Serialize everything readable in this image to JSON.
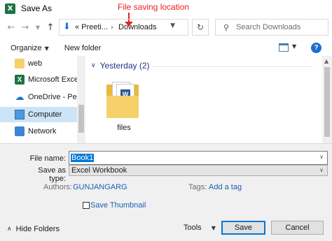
{
  "window": {
    "title": "Save As",
    "app_icon_letter": "X"
  },
  "annotation": {
    "text": "File saving location",
    "color": "#e8231f"
  },
  "nav": {
    "back_icon": "arrow-left-icon",
    "forward_icon": "arrow-right-icon",
    "recent_icon": "chevron-down-icon",
    "up_icon": "arrow-up-icon",
    "address": {
      "overflow": "«",
      "segments": [
        "Preeti...",
        "Downloads"
      ]
    },
    "search": {
      "placeholder": "Search Downloads"
    }
  },
  "toolbar": {
    "organize_label": "Organize",
    "new_folder_label": "New folder"
  },
  "sidebar": {
    "items": [
      {
        "label": "web",
        "icon": "folder-icon"
      },
      {
        "label": "Microsoft Excel",
        "icon": "excel-icon"
      },
      {
        "label": "OneDrive - Persor",
        "icon": "onedrive-icon"
      },
      {
        "label": "Computer",
        "icon": "computer-icon",
        "selected": true
      },
      {
        "label": "Network",
        "icon": "network-icon"
      }
    ]
  },
  "main": {
    "group_heading": "Yesterday (2)",
    "files": [
      {
        "name": "files",
        "icon": "folder-with-documents-icon"
      }
    ]
  },
  "form": {
    "file_name_label": "File name:",
    "file_name_value": "Book1",
    "save_as_type_label": "Save as type:",
    "save_as_type_value": "Excel Workbook",
    "authors_label": "Authors:",
    "authors_value": "GUNJANGARG",
    "tags_label": "Tags:",
    "tags_value": "Add a tag",
    "save_thumbnail_label": "Save Thumbnail",
    "save_thumbnail_checked": false
  },
  "footer": {
    "hide_folders_label": "Hide Folders",
    "tools_label": "Tools",
    "save_label": "Save",
    "cancel_label": "Cancel"
  },
  "colors": {
    "accent": "#0078d7",
    "link": "#1a5fb4",
    "group_heading": "#1e3287",
    "excel_green": "#1f7244"
  }
}
